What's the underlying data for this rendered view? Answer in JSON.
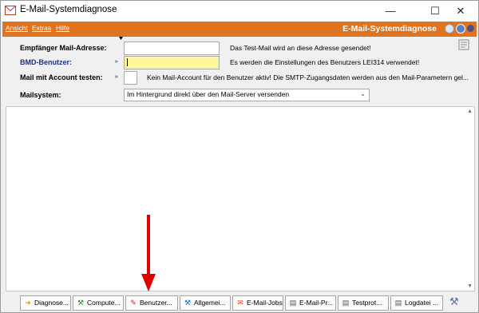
{
  "window": {
    "title": "E-Mail-Systemdiagnose"
  },
  "menu": {
    "items": [
      "Ansicht",
      "Extras",
      "Hilfe"
    ],
    "header_title": "E-Mail-Systemdiagnose"
  },
  "form": {
    "recipient": {
      "label": "Empfänger Mail-Adresse:",
      "value": "",
      "hint": "Das Test-Mail wird an diese Adresse gesendet!"
    },
    "bmd_user": {
      "label": "BMD-Benutzer:",
      "value": "",
      "hint": "Es werden die Einstellungen des Benutzers LEI314 verwendet!"
    },
    "test_with_account": {
      "label": "Mail mit Account testen:",
      "checked": false,
      "hint": "Kein Mail-Account für den Benutzer aktiv! Die SMTP-Zugangsdaten werden aus den Mail-Parametern gel..."
    },
    "mailsystem": {
      "label": "Mailsystem:",
      "selected": "Im Hintergrund direkt über den Mail-Server versenden"
    }
  },
  "toolbar": {
    "buttons": [
      {
        "label": "Diagnose...",
        "icon": "arrow-right-icon"
      },
      {
        "label": "Compute...",
        "icon": "wrench-icon"
      },
      {
        "label": "Benutzer...",
        "icon": "pencil-icon"
      },
      {
        "label": "Allgemei...",
        "icon": "wrench-icon"
      },
      {
        "label": "E-Mail-Jobs",
        "icon": "mail-jobs-icon"
      },
      {
        "label": "E-Mail-Pr...",
        "icon": "document-icon"
      },
      {
        "label": "Testprot...",
        "icon": "log-icon"
      },
      {
        "label": "Logdatei ...",
        "icon": "document-icon"
      }
    ]
  },
  "colors": {
    "accent": "#e0731f",
    "highlight_field": "#fff59d",
    "annotation_arrow": "#e00000",
    "bmd_label": "#1f2f7a"
  }
}
